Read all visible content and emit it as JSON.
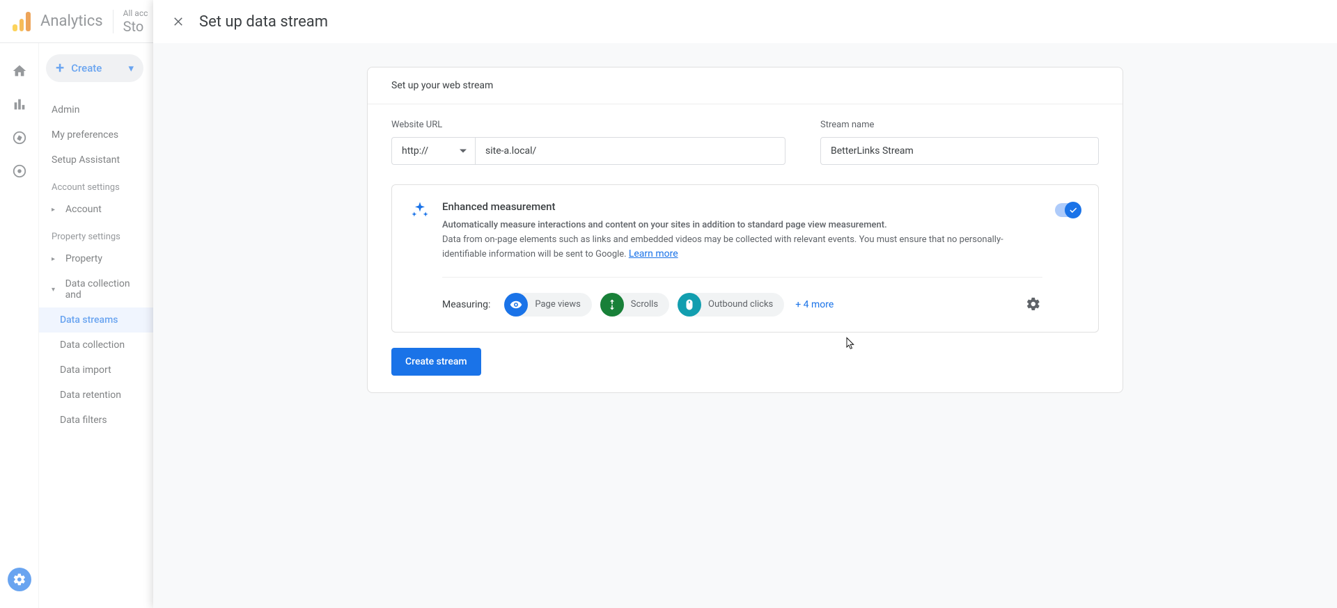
{
  "header": {
    "product": "Analytics",
    "accounts_line": "All acc",
    "property_line": "Sto"
  },
  "sidebar": {
    "create_label": "Create",
    "items": {
      "admin": "Admin",
      "my_prefs": "My preferences",
      "setup_assistant": "Setup Assistant"
    },
    "account_section": "Account settings",
    "account_item": "Account",
    "property_section": "Property settings",
    "property_item": "Property",
    "data_collection_parent": "Data collection and",
    "children": {
      "data_streams": "Data streams",
      "data_collection": "Data collection",
      "data_import": "Data import",
      "data_retention": "Data retention",
      "data_filters": "Data filters"
    }
  },
  "modal": {
    "title": "Set up data stream",
    "card_header": "Set up your web stream",
    "website_url_label": "Website URL",
    "protocol": "http://",
    "url_value": "site-a.local/",
    "stream_name_label": "Stream name",
    "stream_name_value": "BetterLinks Stream",
    "enhanced": {
      "title": "Enhanced measurement",
      "sub1": "Automatically measure interactions and content on your sites in addition to standard page view measurement.",
      "sub2": "Data from on-page elements such as links and embedded videos may be collected with relevant events. You must ensure that no personally-identifiable information will be sent to Google. ",
      "learn": "Learn more"
    },
    "measuring_label": "Measuring:",
    "pills": {
      "page_views": "Page views",
      "scrolls": "Scrolls",
      "outbound": "Outbound clicks"
    },
    "more": "+ 4 more",
    "create_button": "Create stream"
  }
}
